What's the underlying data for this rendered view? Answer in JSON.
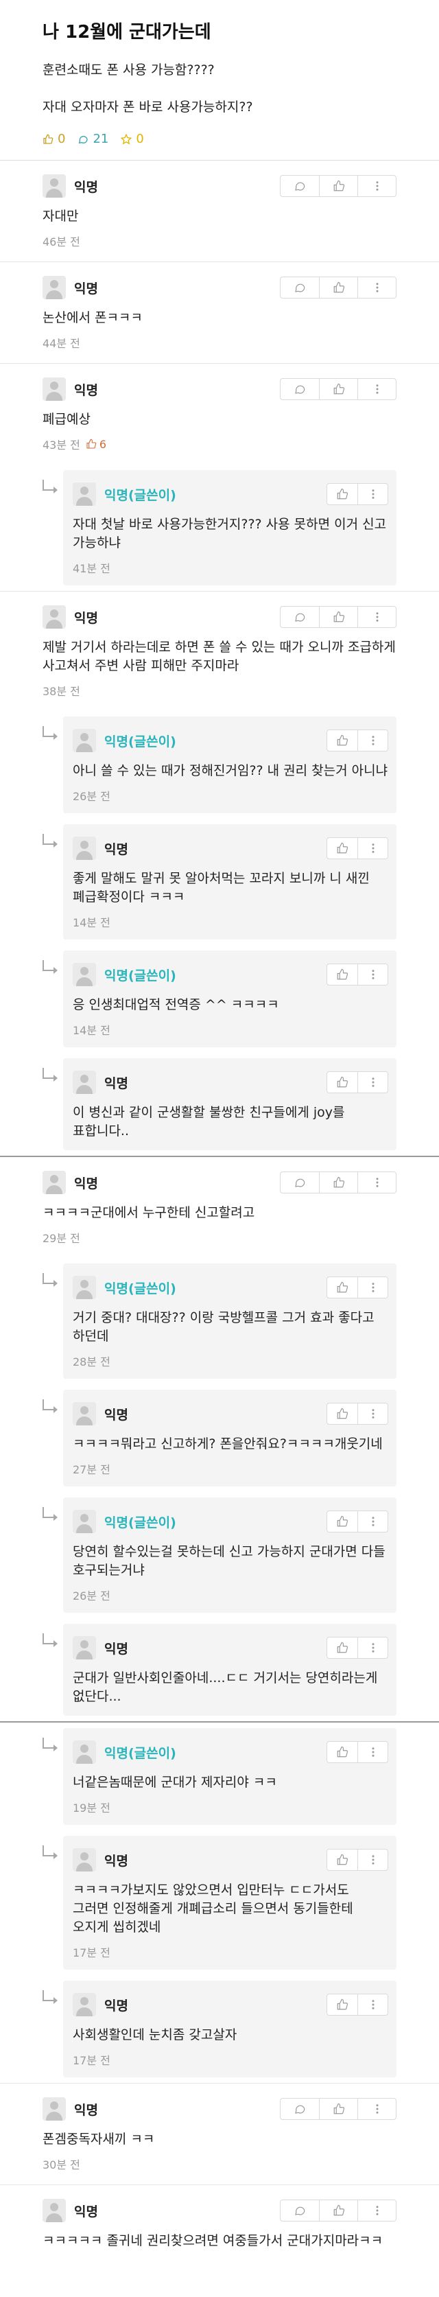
{
  "post": {
    "title": "나 12월에 군대가는데",
    "lines": [
      "훈련소때도 폰 사용 가능함????",
      "자대 오자마자 폰 바로 사용가능하지??"
    ],
    "likes": "0",
    "comments": "21",
    "scraps": "0"
  },
  "comments": [
    {
      "name": "익명",
      "text": "자대만",
      "time": "46분 전",
      "reply": false,
      "op": false,
      "likes": ""
    },
    {
      "name": "익명",
      "text": "논산에서 폰ㅋㅋㅋ",
      "time": "44분 전",
      "reply": false,
      "op": false,
      "likes": ""
    },
    {
      "name": "익명",
      "text": "폐급예상",
      "time": "43분 전",
      "reply": false,
      "op": false,
      "likes": "6"
    },
    {
      "name": "익명(글쓴이)",
      "text": "자대 첫날 바로 사용가능한거지??? 사용 못하면 이거 신고 가능하냐",
      "time": "41분 전",
      "reply": true,
      "op": true,
      "likes": ""
    },
    {
      "name": "익명",
      "text": "제발 거기서 하라는데로 하면 폰 쓸 수 있는 때가 오니까 조급하게 사고쳐서 주변 사람 피해만 주지마라",
      "time": "38분 전",
      "reply": false,
      "op": false,
      "likes": ""
    },
    {
      "name": "익명(글쓴이)",
      "text": "아니 쓸 수 있는 때가 정해진거임?? 내 권리 찾는거 아니냐",
      "time": "26분 전",
      "reply": true,
      "op": true,
      "likes": ""
    },
    {
      "name": "익명",
      "text": "좋게 말해도 말귀 못 알아처먹는 꼬라지 보니까 니 새낀 폐급확정이다 ㅋㅋㅋ",
      "time": "14분 전",
      "reply": true,
      "op": false,
      "likes": ""
    },
    {
      "name": "익명(글쓴이)",
      "text": "응 인생최대업적 전역증 ^^ ㅋㅋㅋㅋ",
      "time": "14분 전",
      "reply": true,
      "op": true,
      "likes": ""
    },
    {
      "name": "익명",
      "text": "이 병신과 같이 군생활할 불쌍한 친구들에게 joy를 표합니다..",
      "time": "",
      "reply": true,
      "op": false,
      "likes": ""
    },
    {
      "name": "익명",
      "text": "ㅋㅋㅋㅋ군대에서 누구한테 신고할려고",
      "time": "29분 전",
      "reply": false,
      "op": false,
      "likes": "",
      "sep": true
    },
    {
      "name": "익명(글쓴이)",
      "text": "거기 중대? 대대장?? 이랑 국방헬프콜 그거 효과 좋다고 하던데",
      "time": "28분 전",
      "reply": true,
      "op": true,
      "likes": ""
    },
    {
      "name": "익명",
      "text": "ㅋㅋㅋㅋ뭐라고 신고하게? 폰을안줘요?ㅋㅋㅋㅋ개웃기네",
      "time": "27분 전",
      "reply": true,
      "op": false,
      "likes": ""
    },
    {
      "name": "익명(글쓴이)",
      "text": "당연히 할수있는걸 못하는데 신고 가능하지 군대가면 다들 호구되는거냐",
      "time": "26분 전",
      "reply": true,
      "op": true,
      "likes": ""
    },
    {
      "name": "익명",
      "text": "군대가 일반사회인줄아네....ㄷㄷ 거기서는 당연히라는게 없단다...",
      "time": "",
      "reply": true,
      "op": false,
      "likes": ""
    },
    {
      "name": "익명(글쓴이)",
      "text": "너같은놈때문에 군대가 제자리야 ㅋㅋ",
      "time": "19분 전",
      "reply": true,
      "op": true,
      "likes": "",
      "sep": true
    },
    {
      "name": "익명",
      "text": "ㅋㅋㅋㅋ가보지도 않았으면서 입만터누 ㄷㄷ가서도 그러면 인정해줄게 개폐급소리 들으면서 동기들한테 오지게 씹히겠네",
      "time": "17분 전",
      "reply": true,
      "op": false,
      "likes": ""
    },
    {
      "name": "익명",
      "text": "사회생활인데 눈치좀 갖고살자",
      "time": "17분 전",
      "reply": true,
      "op": false,
      "likes": ""
    },
    {
      "name": "익명",
      "text": "폰겜중독자새끼 ㅋㅋ",
      "time": "30분 전",
      "reply": false,
      "op": false,
      "likes": ""
    },
    {
      "name": "익명",
      "text": "ㅋㅋㅋㅋㅋ 졸귀네 권리찾으려면 여중들가서 군대가지마라ㅋㅋ",
      "time": "",
      "reply": false,
      "op": false,
      "likes": ""
    }
  ]
}
